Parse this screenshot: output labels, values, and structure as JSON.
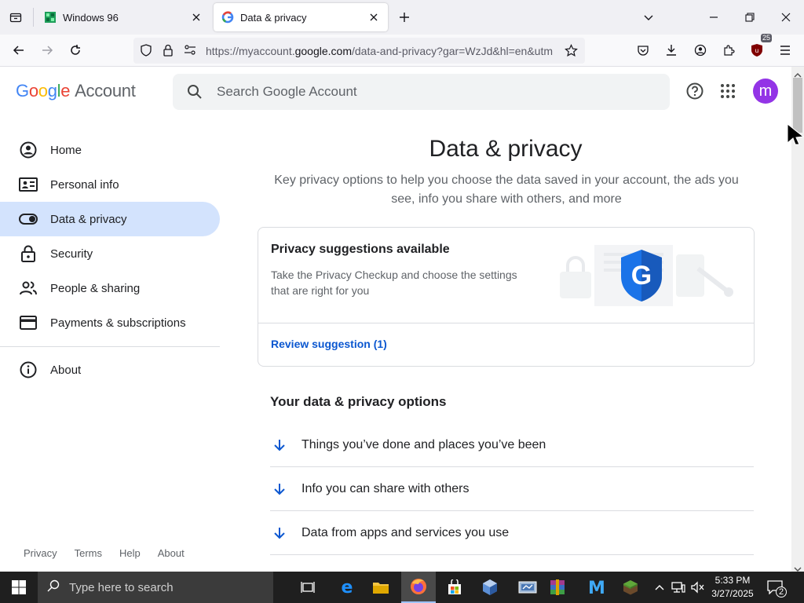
{
  "browser": {
    "tabs": [
      {
        "label": "Windows 96",
        "active": false
      },
      {
        "label": "Data & privacy",
        "active": true
      }
    ],
    "url_prefix": "https://myaccount.",
    "url_domain": "google.com",
    "url_rest": "/data-and-privacy?gar=WzJd&hl=en&utm",
    "extension_badge": "25"
  },
  "header": {
    "logo_google": "Google",
    "logo_account": "Account",
    "search_placeholder": "Search Google Account",
    "avatar_letter": "m"
  },
  "sidebar": {
    "items": [
      {
        "label": "Home",
        "icon": "home-icon"
      },
      {
        "label": "Personal info",
        "icon": "id-card-icon"
      },
      {
        "label": "Data & privacy",
        "icon": "toggle-icon",
        "active": true
      },
      {
        "label": "Security",
        "icon": "lock-icon"
      },
      {
        "label": "People & sharing",
        "icon": "people-icon"
      },
      {
        "label": "Payments & subscriptions",
        "icon": "credit-card-icon"
      },
      {
        "label": "About",
        "icon": "info-icon"
      }
    ],
    "footer": [
      "Privacy",
      "Terms",
      "Help",
      "About"
    ]
  },
  "main": {
    "title": "Data & privacy",
    "subtitle": "Key privacy options to help you choose the data saved in your account, the ads you see, info you share with others, and more",
    "card": {
      "title": "Privacy suggestions available",
      "description": "Take the Privacy Checkup and choose the settings that are right for you",
      "action": "Review suggestion (1)"
    },
    "section_title": "Your data & privacy options",
    "options": [
      "Things you’ve done and places you’ve been",
      "Info you can share with others",
      "Data from apps and services you use"
    ]
  },
  "taskbar": {
    "search_placeholder": "Type here to search",
    "time": "5:33 PM",
    "date": "3/27/2025",
    "notifications": "2"
  },
  "colors": {
    "accent_blue": "#0b57d0",
    "active_nav_bg": "#d3e3fd",
    "avatar_bg": "#9334e6"
  }
}
